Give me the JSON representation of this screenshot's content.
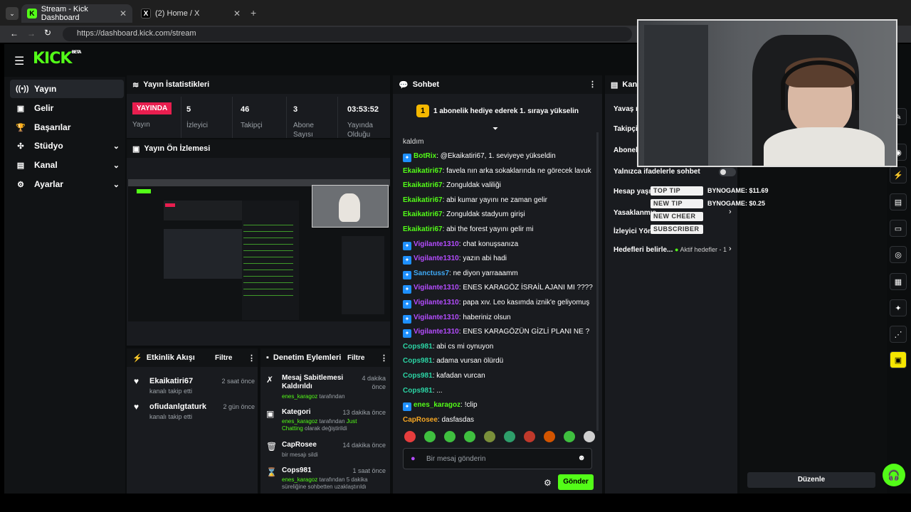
{
  "browser": {
    "tabs": [
      {
        "title": "Stream - Kick Dashboard",
        "icon": "kick-favicon"
      },
      {
        "title": "(2) Home / X",
        "icon": "x-favicon"
      }
    ],
    "new_tab": "+",
    "url": "https://dashboard.kick.com/stream"
  },
  "brand": {
    "logo": "KICK",
    "beta": "BETA"
  },
  "nav": {
    "items": [
      {
        "label": "Yayın",
        "icon": "broadcast-icon"
      },
      {
        "label": "Gelir",
        "icon": "revenue-icon"
      },
      {
        "label": "Başarılar",
        "icon": "trophy-icon"
      },
      {
        "label": "Stüdyo",
        "icon": "studio-icon"
      },
      {
        "label": "Kanal",
        "icon": "channel-icon"
      },
      {
        "label": "Ayarlar",
        "icon": "gear-icon"
      }
    ]
  },
  "stats": {
    "title": "Yayın İstatistikleri",
    "live_badge": "YAYINDA",
    "live_label": "Yayın",
    "viewers": {
      "value": "5",
      "label": "İzleyici"
    },
    "followers": {
      "value": "46",
      "label": "Takipçi"
    },
    "subs": {
      "value": "3",
      "label": "Abone Sayısı"
    },
    "uptime": {
      "value": "03:53:52",
      "label": "Yayında Olduğu"
    }
  },
  "preview": {
    "title": "Yayın Ön İzlemesi"
  },
  "chat": {
    "title": "Sohbet",
    "pinned": "1 abonelik hediye ederek 1. sıraya yükselin",
    "pinned_rank": "1",
    "partial_top": "kaldım",
    "messages": [
      {
        "user": "BotRix",
        "text": "@Ekaikatiri67, 1. seviyeye yükseldin",
        "color": "#53fc18",
        "badge": true
      },
      {
        "user": "Ekaikatiri67",
        "text": "favela nın arka sokaklarında ne görecek lavuk",
        "color": "#53fc18"
      },
      {
        "user": "Ekaikatiri67",
        "text": "Zonguldak valiliği",
        "color": "#53fc18"
      },
      {
        "user": "Ekaikatiri67",
        "text": "abi kumar yayını ne zaman gelir",
        "color": "#53fc18"
      },
      {
        "user": "Ekaikatiri67",
        "text": "Zonguldak stadyum girişi",
        "color": "#53fc18"
      },
      {
        "user": "Ekaikatiri67",
        "text": "abi the forest yayını gelir mi",
        "color": "#53fc18"
      },
      {
        "user": "Vigilante1310",
        "text": "chat konuşsanıza",
        "color": "#b44cff",
        "badge": true
      },
      {
        "user": "Vigilante1310",
        "text": "yazın abi hadi",
        "color": "#b44cff",
        "badge": true
      },
      {
        "user": "Sanctuss7",
        "text": "ne diyon yarraaamm",
        "color": "#3fa9f5",
        "badge": true
      },
      {
        "user": "Vigilante1310",
        "text": "ENES KARAGÖZ İSRAİL AJANI MI ????",
        "color": "#b44cff",
        "badge": true
      },
      {
        "user": "Vigilante1310",
        "text": "papa xıv. Leo kasımda iznik'e geliyomuş",
        "color": "#b44cff",
        "badge": true
      },
      {
        "user": "Vigilante1310",
        "text": "haberiniz olsun",
        "color": "#b44cff",
        "badge": true
      },
      {
        "user": "Vigilante1310",
        "text": "ENES KARAGÖZÜN GİZLİ PLANI NE ?",
        "color": "#b44cff",
        "badge": true
      },
      {
        "user": "Cops981",
        "text": "abi cs mi oynuyon",
        "color": "#2bd4a4"
      },
      {
        "user": "Cops981",
        "text": "adama vursan ölürdü",
        "color": "#2bd4a4"
      },
      {
        "user": "Cops981",
        "text": "kafadan vurcan",
        "color": "#2bd4a4"
      },
      {
        "user": "Cops981",
        "text": "...",
        "color": "#2bd4a4"
      },
      {
        "user": "enes_karagoz",
        "text": "!clip",
        "color": "#53fc18",
        "badge": true
      },
      {
        "user": "CapRosee",
        "text": "dasfasdas",
        "color": "#f5a623"
      }
    ],
    "input_placeholder": "Bir mesaj gönderin",
    "send_label": "Gönder"
  },
  "activity": {
    "title": "Etkinlik Akışı",
    "filter": "Filtre",
    "items": [
      {
        "user": "Ekaikatiri67",
        "action": "kanalı takip etti",
        "time": "2 saat önce"
      },
      {
        "user": "ofiudanlgtaturk",
        "action": "kanalı takip etti",
        "time": "2 gün önce"
      }
    ]
  },
  "moderation": {
    "title": "Denetim Eylemleri",
    "filter": "Filtre",
    "items": [
      {
        "title": "Mesaj Sabitlemesi Kaldırıldı",
        "by": "enes_karagoz",
        "suffix": "tarafından",
        "time": "4 dakika önce",
        "icon": "unpin-icon"
      },
      {
        "title": "Kategori",
        "by": "enes_karagoz",
        "suffix": "tarafından",
        "extra": "Just Chatting",
        "extra_suffix": "olarak değiştirildi",
        "time": "13 dakika önce",
        "icon": "category-icon"
      },
      {
        "title": "CapRosee",
        "desc": "bir mesajı sildi",
        "time": "14 dakika önce",
        "icon": "trash-icon"
      },
      {
        "title": "Cops981",
        "by": "enes_karagoz",
        "suffix": "tarafından 5 dakika süreliğine sohbetten uzaklaştırıldı",
        "time": "1 saat önce",
        "icon": "hourglass-icon"
      }
    ]
  },
  "channel": {
    "title": "Kanal",
    "rows": [
      "Yavaş m",
      "Takipçile",
      "Abonele",
      "Yalnızca ifadelerle sohbet",
      "Hesap yaşı k",
      "Yasaklanmış",
      "İzleyici Yönle",
      "Hedefleri belirle..."
    ],
    "goal_status": "Aktif hedefler - 1",
    "edit_label": "Düzenle"
  },
  "overlay": {
    "alerts": [
      "TOP TIP",
      "NEW TIP",
      "NEW CHEER",
      "SUBSCRIBER"
    ],
    "tip1": "BYNOGAME: $11.69",
    "tip2": "BYNOGAME: $0.25"
  },
  "colors": {
    "brand": "#53fc18",
    "live": "#e91e4f"
  }
}
